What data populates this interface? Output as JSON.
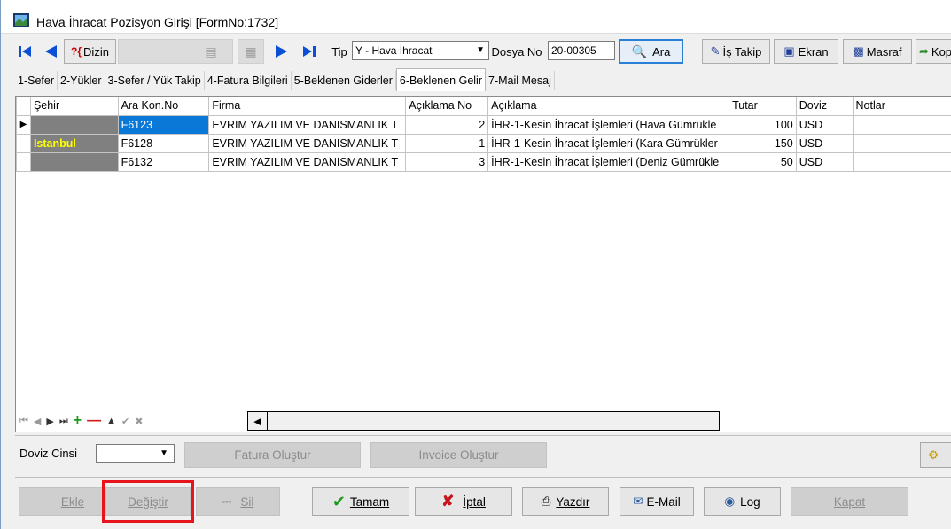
{
  "window": {
    "title": "Hava İhracat Pozisyon Girişi [FormNo:1732]"
  },
  "toolbar": {
    "index_label": "Dizin",
    "tip_label": "Tip",
    "tip_value": "Y - Hava İhracat",
    "dosya_label": "Dosya No",
    "dosya_value": "20-00305",
    "ara_label": "Ara",
    "is_takip_label": "İş Takip",
    "ekran_label": "Ekran",
    "masraf_label": "Masraf",
    "kop_label": "Kop"
  },
  "tabs": [
    {
      "label": "1-Sefer"
    },
    {
      "label": "2-Yükler"
    },
    {
      "label": "3-Sefer / Yük Takip"
    },
    {
      "label": "4-Fatura Bilgileri"
    },
    {
      "label": "5-Beklenen Giderler"
    },
    {
      "label": "6-Beklenen Gelir"
    },
    {
      "label": "7-Mail Mesaj"
    }
  ],
  "active_tab": "6-Beklenen Gelir",
  "grid": {
    "columns": [
      "Şehir",
      "Ara Kon.No",
      "Firma",
      "Açıklama No",
      "Açıklama",
      "Tutar",
      "Doviz",
      "Notlar"
    ],
    "city_label": "Istanbul",
    "rows": [
      {
        "kon": "F6123",
        "firma": "EVRIM YAZILIM VE DANISMANLIK T",
        "no": "2",
        "aciklama": "İHR-1-Kesin İhracat İşlemleri (Hava Gümrükle",
        "tutar": "100",
        "doviz": "USD",
        "notlar": ""
      },
      {
        "kon": "F6128",
        "firma": "EVRIM YAZILIM VE DANISMANLIK T",
        "no": "1",
        "aciklama": "İHR-1-Kesin İhracat İşlemleri (Kara Gümrükler",
        "tutar": "150",
        "doviz": "USD",
        "notlar": ""
      },
      {
        "kon": "F6132",
        "firma": "EVRIM YAZILIM VE DANISMANLIK T",
        "no": "3",
        "aciklama": "İHR-1-Kesin İhracat İşlemleri (Deniz Gümrükle",
        "tutar": "50",
        "doviz": "USD",
        "notlar": ""
      }
    ]
  },
  "footer": {
    "doviz_cinsi_label": "Doviz Cinsi",
    "doviz_cinsi_value": "",
    "fatura_olustur": "Fatura Oluştur",
    "invoice_olustur": "Invoice Oluştur"
  },
  "actions": {
    "ekle": "Ekle",
    "degistir": "Değiştir",
    "sil": "Sil",
    "tamam": "Tamam",
    "iptal": "İptal",
    "yazdir": "Yazdır",
    "email": "E-Mail",
    "log": "Log",
    "kapat": "Kapat"
  },
  "colors": {
    "selection": "#0a78d7",
    "city_bg": "#808080",
    "city_text": "#ffff00",
    "highlight": "#e8141c"
  }
}
